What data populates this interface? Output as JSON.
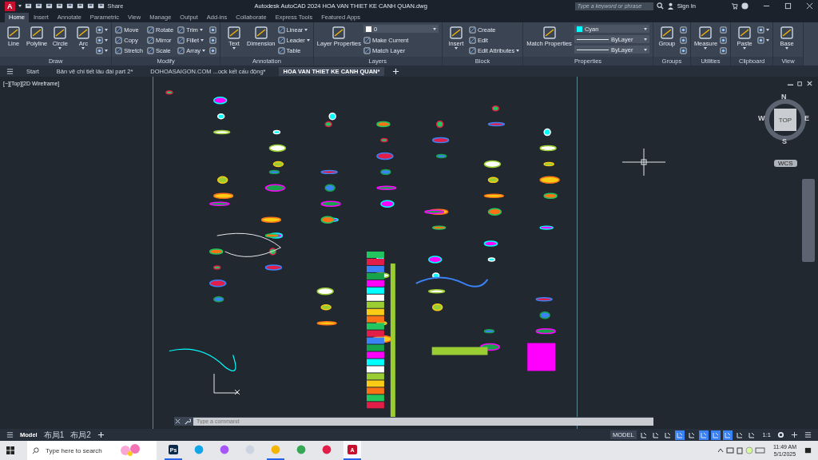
{
  "title_bar": {
    "logo": "A",
    "share": "Share",
    "title": "Autodesk AutoCAD 2024  HOA VAN THIET KE CANH QUAN.dwg",
    "search": {
      "placeholder": "Type a keyword or phrase"
    },
    "sign_in": "Sign In"
  },
  "ribbon_tabs": [
    {
      "label": "Home",
      "selected": true
    },
    {
      "label": "Insert",
      "selected": false
    },
    {
      "label": "Annotate",
      "selected": false
    },
    {
      "label": "Parametric",
      "selected": false
    },
    {
      "label": "View",
      "selected": false
    },
    {
      "label": "Manage",
      "selected": false
    },
    {
      "label": "Output",
      "selected": false
    },
    {
      "label": "Add-ins",
      "selected": false
    },
    {
      "label": "Collaborate",
      "selected": false
    },
    {
      "label": "Express Tools",
      "selected": false
    },
    {
      "label": "Featured Apps",
      "selected": false
    }
  ],
  "ribbon_panels": [
    {
      "title": "Draw",
      "tools": [
        {
          "kind": "large",
          "label": "Line",
          "menu": false
        },
        {
          "kind": "large",
          "label": "Polyline",
          "menu": false
        },
        {
          "kind": "large",
          "label": "Circle",
          "menu": true
        },
        {
          "kind": "large",
          "label": "Arc",
          "menu": true
        },
        {
          "kind": "icon",
          "menu": true
        },
        {
          "kind": "icon",
          "menu": true
        },
        {
          "kind": "icon",
          "menu": true
        }
      ]
    },
    {
      "title": "Modify",
      "tools": [
        {
          "kind": "small",
          "label": "Move",
          "menu": false
        },
        {
          "kind": "small",
          "label": "Copy",
          "menu": false
        },
        {
          "kind": "small",
          "label": "Stretch",
          "menu": false
        },
        {
          "kind": "small",
          "label": "Rotate",
          "menu": false
        },
        {
          "kind": "small",
          "label": "Mirror",
          "menu": false
        },
        {
          "kind": "small",
          "label": "Scale",
          "menu": false
        },
        {
          "kind": "small",
          "label": "Trim",
          "menu": true
        },
        {
          "kind": "small",
          "label": "Fillet",
          "menu": true
        },
        {
          "kind": "small",
          "label": "Array",
          "menu": true
        },
        {
          "kind": "icon",
          "menu": false
        },
        {
          "kind": "icon",
          "menu": false
        },
        {
          "kind": "icon",
          "menu": false
        }
      ]
    },
    {
      "title": "Annotation",
      "tools": [
        {
          "kind": "large",
          "label": "Text",
          "menu": true
        },
        {
          "kind": "large",
          "label": "Dimension",
          "menu": false
        },
        {
          "kind": "small",
          "label": "Linear",
          "menu": true
        },
        {
          "kind": "small",
          "label": "Leader",
          "menu": true
        },
        {
          "kind": "small",
          "label": "Table",
          "menu": false
        }
      ]
    },
    {
      "title": "Layers",
      "tools": [
        {
          "kind": "large",
          "label": "Layer Properties",
          "menu": false
        },
        {
          "kind": "dropdown",
          "value": "0",
          "color": "#ffffff",
          "menu": true
        },
        {
          "kind": "small",
          "label": "Make Current",
          "menu": false
        },
        {
          "kind": "small",
          "label": "Match Layer",
          "menu": false
        }
      ]
    },
    {
      "title": "Block",
      "tools": [
        {
          "kind": "large",
          "label": "Insert",
          "menu": true
        },
        {
          "kind": "small",
          "label": "Create",
          "menu": false
        },
        {
          "kind": "small",
          "label": "Edit",
          "menu": false
        },
        {
          "kind": "small",
          "label": "Edit Attributes",
          "menu": true
        }
      ]
    },
    {
      "title": "Properties",
      "tools": [
        {
          "kind": "large",
          "label": "Match Properties",
          "menu": false
        },
        {
          "kind": "dropdown",
          "value": "Cyan",
          "color": "#00ffff",
          "menu": true
        },
        {
          "kind": "dropdown",
          "value": "ByLayer",
          "menu": true
        },
        {
          "kind": "dropdown",
          "value": "ByLayer",
          "menu": true
        }
      ]
    },
    {
      "title": "Groups",
      "tools": [
        {
          "kind": "large",
          "label": "Group",
          "menu": false
        },
        {
          "kind": "icon",
          "menu": false
        },
        {
          "kind": "icon",
          "menu": false
        },
        {
          "kind": "icon",
          "menu": false
        }
      ]
    },
    {
      "title": "Utilities",
      "tools": [
        {
          "kind": "large",
          "label": "Measure",
          "menu": true
        },
        {
          "kind": "icon",
          "menu": false
        },
        {
          "kind": "icon",
          "menu": false
        },
        {
          "kind": "icon",
          "menu": false
        }
      ]
    },
    {
      "title": "Clipboard",
      "tools": [
        {
          "kind": "large",
          "label": "Paste",
          "menu": true
        },
        {
          "kind": "icon",
          "menu": true
        },
        {
          "kind": "icon",
          "menu": true
        }
      ]
    },
    {
      "title": "View",
      "tools": [
        {
          "kind": "large",
          "label": "Base",
          "menu": true
        }
      ]
    }
  ],
  "doc_tabs": [
    {
      "label": "Start",
      "selected": false
    },
    {
      "label": "Bản vẽ chi tiết lâu đài part 2*",
      "selected": false
    },
    {
      "label": "DOHOASAIGON.COM ...ock kết cấu động*",
      "selected": false
    },
    {
      "label": "HOA VAN THIET KE CANH QUAN*",
      "selected": true
    }
  ],
  "viewport": {
    "label": "[−][Top][2D Wireframe]",
    "viewcube": {
      "north": "N",
      "south": "S",
      "east": "E",
      "west": "W",
      "top": "TOP"
    },
    "wcs": "WCS"
  },
  "command_line": {
    "placeholder": "Type a command"
  },
  "layout_tabs": [
    {
      "label": "Model",
      "selected": true
    },
    {
      "label": "布局1",
      "selected": false
    },
    {
      "label": "布局2",
      "selected": false
    }
  ],
  "status_bar": {
    "model": "MODEL",
    "toggles": [
      {
        "on": false
      },
      {
        "on": false
      },
      {
        "on": false
      },
      {
        "on": true
      },
      {
        "on": false
      },
      {
        "on": true
      },
      {
        "on": true
      },
      {
        "on": true
      },
      {
        "on": false
      },
      {
        "on": false
      }
    ],
    "scale": "1:1"
  },
  "taskbar": {
    "search": {
      "placeholder": "Type here to search"
    },
    "apps": [
      {
        "kind": "photoshop",
        "label": "Ps",
        "running": true,
        "selected": false
      },
      {
        "kind": "edge",
        "running": false,
        "selected": false
      },
      {
        "kind": "copilot",
        "running": false,
        "selected": false
      },
      {
        "kind": "app",
        "running": false,
        "selected": false
      },
      {
        "kind": "files",
        "running": true,
        "selected": false
      },
      {
        "kind": "chrome",
        "running": false,
        "selected": false
      },
      {
        "kind": "wps",
        "running": false,
        "selected": false
      },
      {
        "kind": "autocad",
        "label": "A",
        "running": true,
        "selected": true
      }
    ],
    "time": "11:49 AM",
    "date": "5/1/2025"
  }
}
